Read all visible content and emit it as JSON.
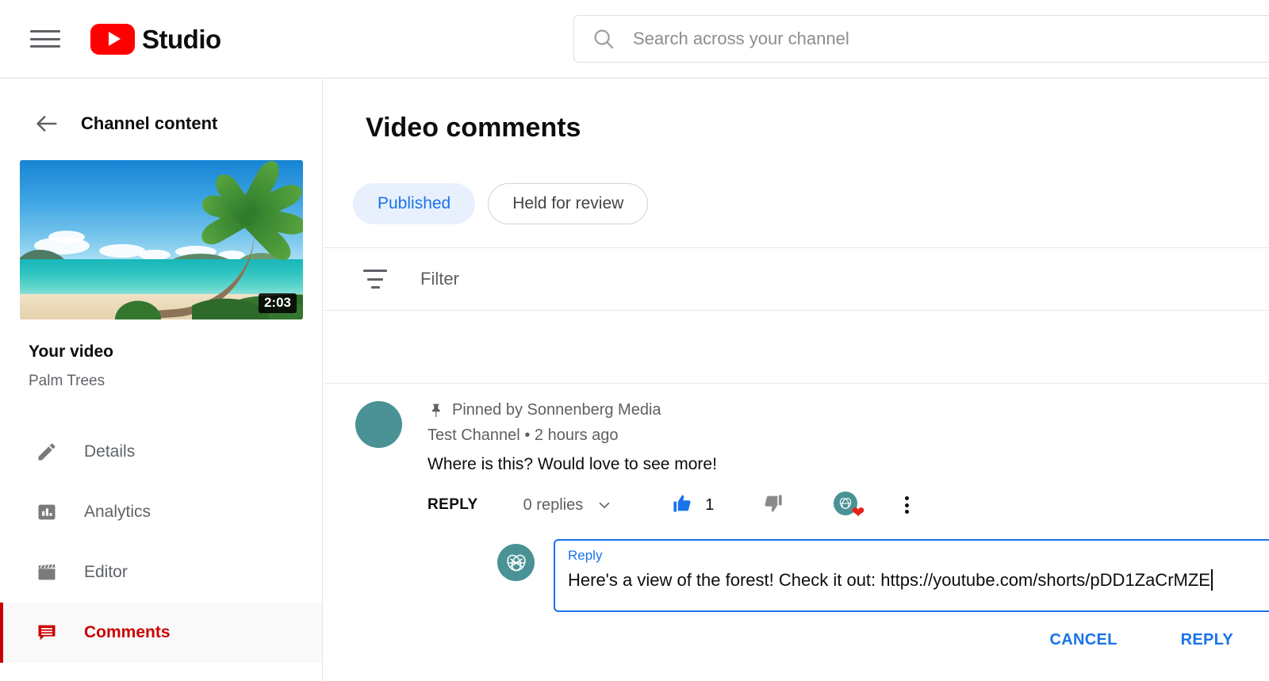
{
  "header": {
    "menu_label": "Menu",
    "brand": "Studio",
    "logo_icon": "youtube-play-icon",
    "search": {
      "placeholder": "Search across your channel",
      "value": "",
      "icon": "search-icon"
    }
  },
  "sidebar": {
    "back_label": "Channel content",
    "back_icon": "arrow-left-icon",
    "video": {
      "duration": "2:03",
      "title": "Your video",
      "name": "Palm Trees",
      "thumbnail_alt": "Tropical beach with palm tree"
    },
    "items": [
      {
        "label": "Details",
        "icon": "pencil-icon",
        "active": false
      },
      {
        "label": "Analytics",
        "icon": "bar-chart-icon",
        "active": false
      },
      {
        "label": "Editor",
        "icon": "clapperboard-icon",
        "active": false
      },
      {
        "label": "Comments",
        "icon": "comment-icon",
        "active": true
      }
    ]
  },
  "main": {
    "title": "Video comments",
    "tabs": [
      {
        "label": "Published",
        "active": true
      },
      {
        "label": "Held for review",
        "active": false
      }
    ],
    "filter": {
      "icon": "filter-icon",
      "placeholder": "Filter",
      "value": ""
    },
    "comment": {
      "pinned_text": "Pinned by Sonnenberg Media",
      "pin_icon": "pin-icon",
      "author": "Test Channel",
      "separator": "•",
      "timestamp": "2 hours ago",
      "text": "Where is this? Would love to see more!",
      "actions": {
        "reply_label": "REPLY",
        "replies_label": "0 replies",
        "replies_chevron_icon": "chevron-down-icon",
        "like_icon": "thumb-up-icon",
        "like_count": "1",
        "dislike_icon": "thumb-down-icon",
        "heart_icon": "heart-icon",
        "more_icon": "more-vertical-icon"
      }
    },
    "composer": {
      "avatar_icon": "channel-avatar-leaf-icon",
      "label": "Reply",
      "value": "Here's a view of the forest! Check it out: https://youtube.com/shorts/pDD1ZaCrMZE",
      "cancel_label": "CANCEL",
      "submit_label": "REPLY"
    }
  },
  "colors": {
    "brand_red": "#ff0000",
    "active_red": "#cc0000",
    "accent_blue": "#1a73e8",
    "chip_active_bg": "#e8f0fe",
    "avatar_teal": "#4a9296",
    "heart_red": "#e62117",
    "text_primary": "#0d0d0d",
    "text_secondary": "#606060"
  }
}
